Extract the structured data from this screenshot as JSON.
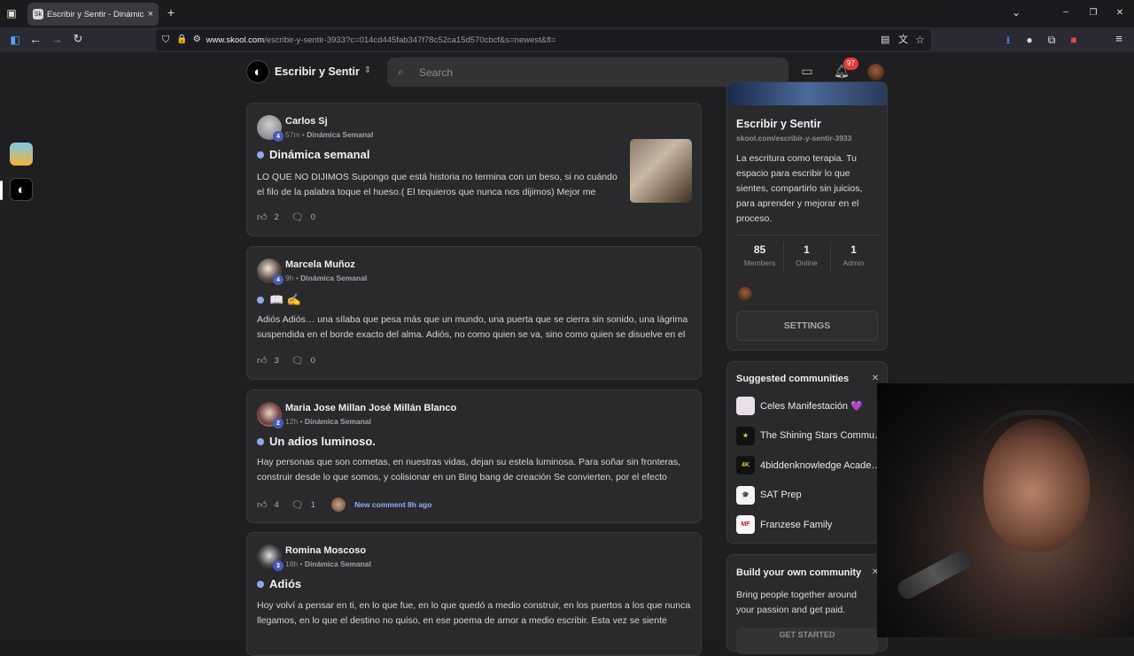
{
  "browser": {
    "tab_title": "Escribir y Sentir - Dinámica Sem",
    "tab_favicon": "Sk",
    "url_host": "www.skool.com",
    "url_path": "/escribir-y-sentir-3933?c=014cd445fab347f78c52ca15d570cbcf&s=newest&fl=",
    "new_tab": "+",
    "close_tab": "×",
    "window_controls": [
      "⌄",
      "–",
      "❐",
      "✕"
    ]
  },
  "header": {
    "community_name": "Escribir y Sentir",
    "search_placeholder": "Search",
    "notifications_count": "97"
  },
  "posts": [
    {
      "author": "Carlos Sj",
      "level": "4",
      "time": "57m",
      "category": "Dinámica Semanal",
      "title": "Dinámica semanal",
      "body": "LO QUE NO DIJIMOS Supongo que está historia no termina con un beso, si no cuándo el filo de la palabra toque el hueso.( El tequieros que nunca nos dijimos) Mejor me",
      "likes": "2",
      "comments": "0"
    },
    {
      "author": "Marcela Muñoz",
      "level": "4",
      "time": "9h",
      "category": "Dinámica Semanal",
      "title": "📖 ✍️",
      "body": "Adiós Adiós… una sílaba que pesa más que un mundo, una puerta que se cierra sin sonido, una lágrima suspendida en el borde exacto del alma. Adiós, no como quien se va, sino como quien se disuelve en el",
      "likes": "3",
      "comments": "0"
    },
    {
      "author": "Maria Jose Millan José Millán Blanco",
      "level": "2",
      "time": "12h",
      "category": "Dinámica Semanal",
      "title": "Un adios luminoso.",
      "body": "Hay personas que son cometas, en nuestras vidas, dejan su estela luminosa. Para soñar sin fronteras, construir desde lo que somos, y colisionar en un Bing bang de creación Se convierten, por el efecto",
      "likes": "4",
      "comments": "1",
      "new_comment": "New comment 8h ago"
    },
    {
      "author": "Romina Moscoso",
      "level": "3",
      "time": "18h",
      "category": "Dinámica Semanal",
      "title": "Adiós",
      "body": "Hoy volví a pensar en ti, en lo que fue, en lo que quedó a medio construir, en los puertos a los que nunca llegamos, en lo que el destino no quiso, en ese poema de amor a medio escribir. Esta vez se siente"
    }
  ],
  "about": {
    "name": "Escribir y Sentir",
    "url": "skool.com/escribir-y-sentir-3933",
    "description": "La escritura como terapia. Tu espacio para escribir lo que sientes, compartirlo sin juicios, para aprender y mejorar en el proceso.",
    "stats": [
      {
        "value": "85",
        "label": "Members"
      },
      {
        "value": "1",
        "label": "Online"
      },
      {
        "value": "1",
        "label": "Admin"
      }
    ],
    "settings_label": "SETTINGS"
  },
  "suggested": {
    "title": "Suggested communities",
    "items": [
      {
        "name": "Celes Manifestación 💜",
        "icon": "",
        "bg": "#e9dfe8",
        "fg": "#222"
      },
      {
        "name": "The Shining Stars Commu…",
        "icon": "★",
        "bg": "#111",
        "fg": "#e2c15a"
      },
      {
        "name": "4biddenknowledge Acade…",
        "icon": "4K",
        "bg": "#111",
        "fg": "#e6c24a"
      },
      {
        "name": "SAT Prep",
        "icon": "🎓",
        "bg": "#f4f4f6",
        "fg": "#6a3aa8"
      },
      {
        "name": "Franzese Family",
        "icon": "MF",
        "bg": "#f7f7f7",
        "fg": "#b5202a"
      }
    ]
  },
  "build": {
    "title": "Build your own community",
    "text": "Bring people together around your passion and get paid.",
    "button": "GET STARTED"
  }
}
